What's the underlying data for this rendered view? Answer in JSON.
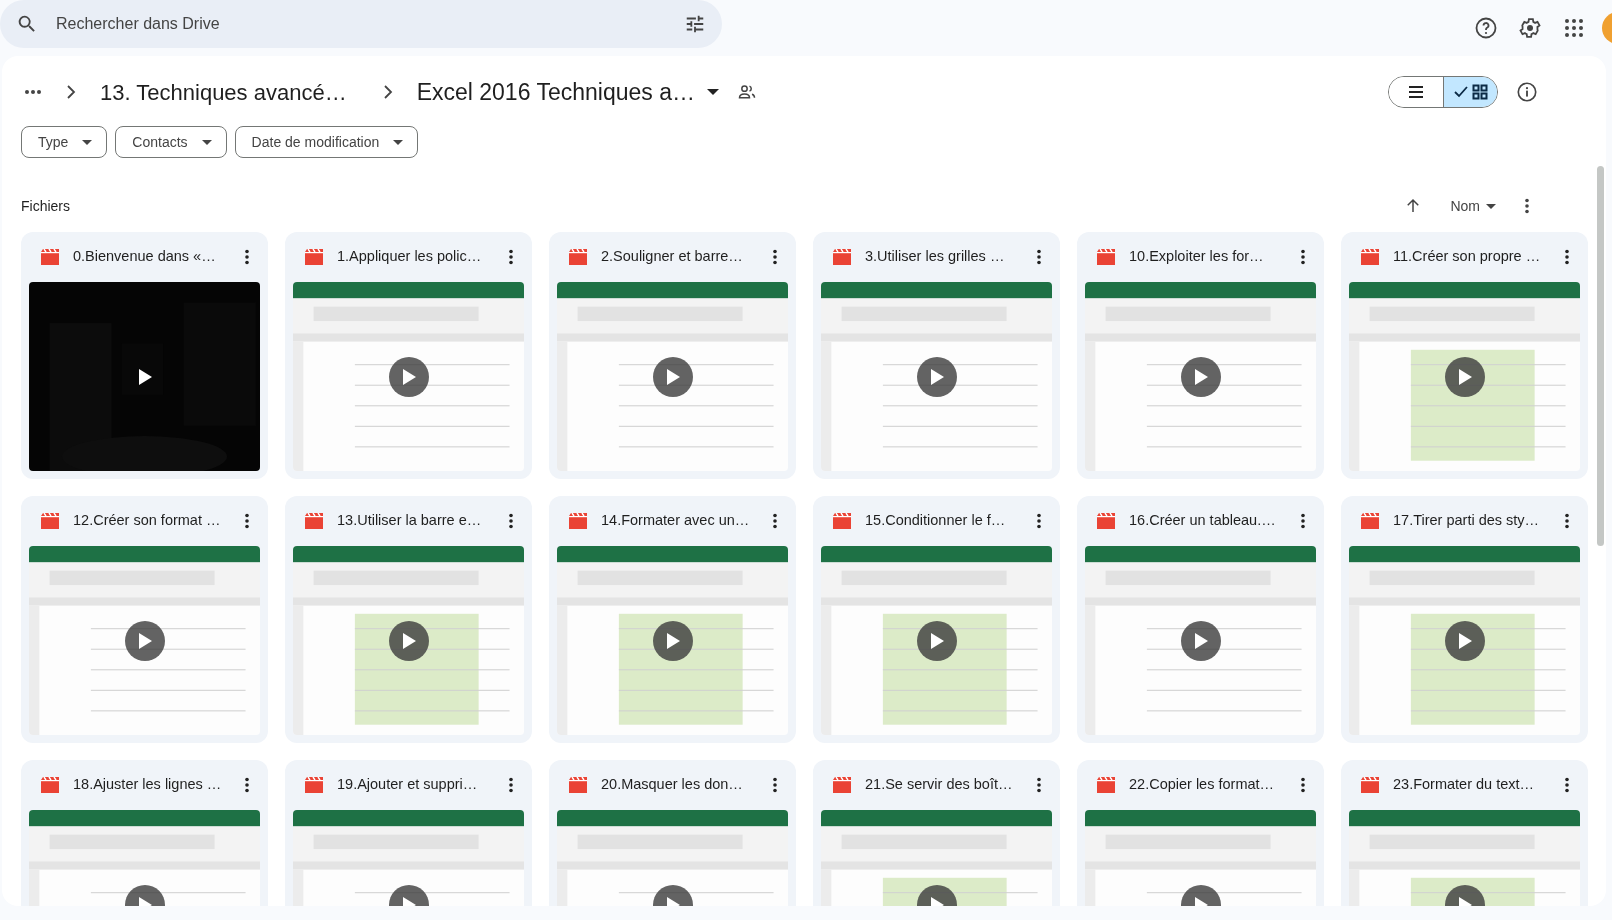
{
  "search": {
    "placeholder": "Rechercher dans Drive"
  },
  "breadcrumb": [
    {
      "label": "13. Techniques avancé…",
      "current": false
    },
    {
      "label": "Excel 2016 Techniques a…",
      "current": true
    }
  ],
  "view_toggle": [
    {
      "kind": "list",
      "selected": false
    },
    {
      "kind": "grid",
      "selected": true
    }
  ],
  "filters": [
    "Type",
    "Contacts",
    "Date de modification"
  ],
  "section_title": "Fichiers",
  "sort": {
    "label": "Nom"
  },
  "files": [
    {
      "title": "0.Bienvenue dans «…"
    },
    {
      "title": "1.Appliquer les polic…"
    },
    {
      "title": "2.Souligner et barre…"
    },
    {
      "title": "3.Utiliser les grilles …"
    },
    {
      "title": "10.Exploiter les for…"
    },
    {
      "title": "11.Créer son propre …"
    },
    {
      "title": "12.Créer son format …"
    },
    {
      "title": "13.Utiliser la barre e…"
    },
    {
      "title": "14.Formater avec un…"
    },
    {
      "title": "15.Conditionner le f…"
    },
    {
      "title": "16.Créer un tableau.…"
    },
    {
      "title": "17.Tirer parti des sty…"
    },
    {
      "title": "18.Ajuster les lignes …"
    },
    {
      "title": "19.Ajouter et suppri…"
    },
    {
      "title": "20.Masquer les don…"
    },
    {
      "title": "21.Se servir des boît…"
    },
    {
      "title": "22.Copier les format…"
    },
    {
      "title": "23.Formater du text…"
    }
  ]
}
